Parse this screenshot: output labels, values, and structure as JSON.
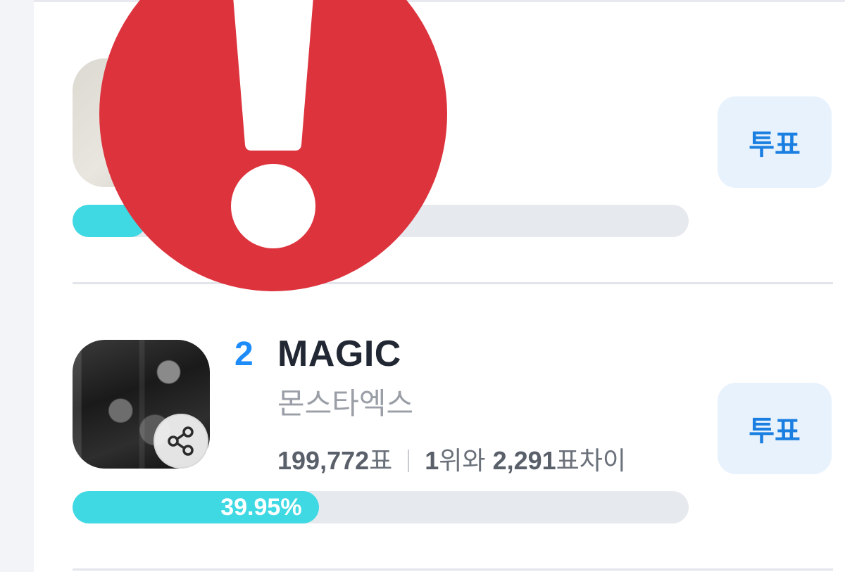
{
  "entries": [
    {
      "vote_label": "투표",
      "progress": 0.12
    },
    {
      "rank": "2",
      "title": "MAGIC",
      "artist": "몬스타엑스",
      "votes": "199,772",
      "votes_unit": "표",
      "rank_ref": "1",
      "rank_ref_unit": "위와",
      "gap": "2,291",
      "gap_unit": "표차이",
      "vote_label": "투표",
      "progress": 0.3995,
      "percent_text": "39.95%"
    }
  ],
  "overlay": {
    "icon": "exclamation-alert-icon",
    "color": "#dd333d"
  },
  "colors": {
    "accent": "#1d8cf8",
    "progress": "#3fd9e3",
    "track": "#e6e9ee",
    "vote_bg": "#e8f2fd"
  }
}
